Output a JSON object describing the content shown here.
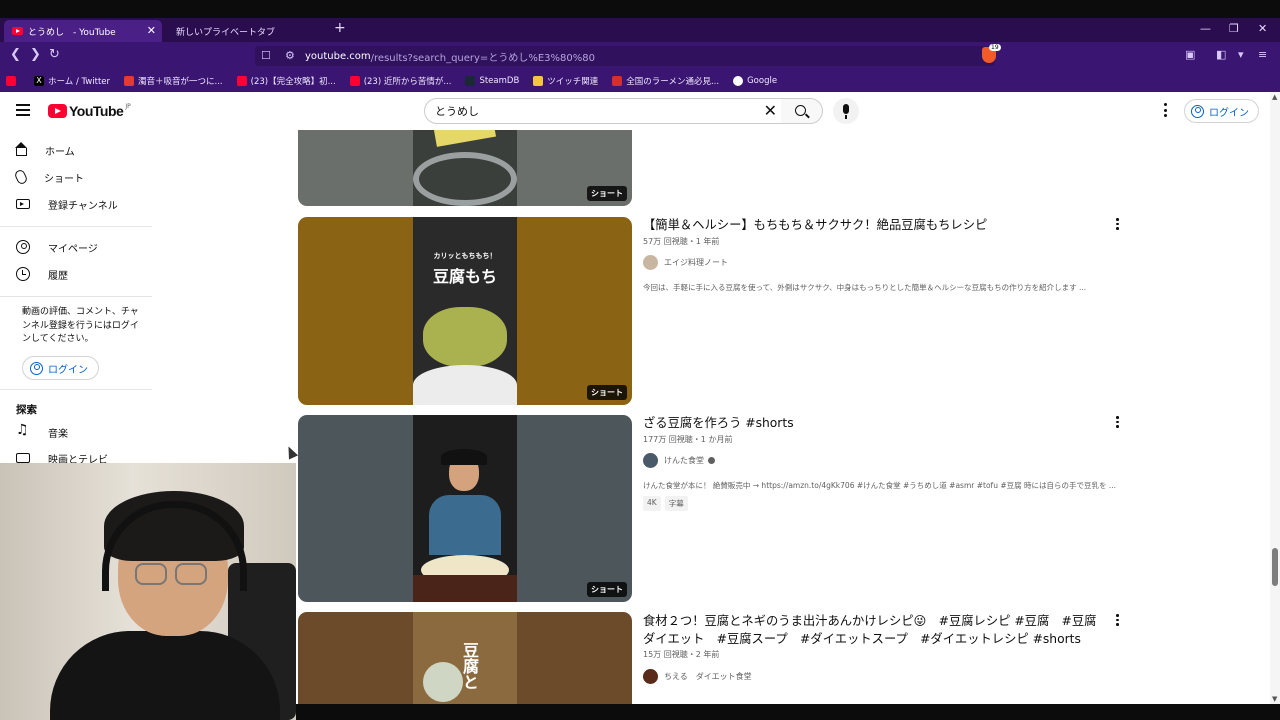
{
  "browser": {
    "tabs": [
      {
        "label": "とうめし　- YouTube",
        "active": true
      },
      {
        "label": "新しいプライベートタブ",
        "active": false
      }
    ],
    "new_tab": "+",
    "close": "✕",
    "window_controls": {
      "minimize": "—",
      "restore": "❐",
      "close": "✕"
    },
    "nav": {
      "back": "❮",
      "forward": "❯",
      "reload": "↻"
    },
    "url_host": "youtube.com",
    "url_path": "/results?search_query=とうめし%E3%80%80",
    "brave_count": "19",
    "bookmarks": [
      {
        "label": "ホーム / Twitter",
        "color": "#000000"
      },
      {
        "label": "濁音＋吸音が一つに...",
        "color": "#ff0033"
      },
      {
        "label": "(23)【完全攻略】初...",
        "color": "#ff0033"
      },
      {
        "label": "(23) 近所から苦情が...",
        "color": "#ff0033"
      },
      {
        "label": "SteamDB",
        "color": "#1b2838"
      },
      {
        "label": "ツイッチ関連",
        "color": "#f5c542"
      },
      {
        "label": "全国のラーメン通必見...",
        "color": "#d32f2f"
      },
      {
        "label": "Google",
        "color": "#ffffff"
      }
    ]
  },
  "youtube": {
    "logo_text": "YouTube",
    "logo_region": "JP",
    "search_value": "とうめし",
    "clear_icon": "✕",
    "login_label": "ログイン",
    "sidebar": {
      "items": [
        {
          "label": "ホーム",
          "icon": "home-icon"
        },
        {
          "label": "ショート",
          "icon": "shorts-icon"
        },
        {
          "label": "登録チャンネル",
          "icon": "subscriptions-icon"
        },
        {
          "label": "マイページ",
          "icon": "you-icon"
        },
        {
          "label": "履歴",
          "icon": "history-icon"
        }
      ],
      "note": "動画の評価、コメント、チャンネル登録を行うにはログインしてください。",
      "login_label": "ログイン",
      "explore_heading": "探索",
      "explore_items": [
        {
          "label": "音楽",
          "icon": "music-icon"
        },
        {
          "label": "映画とテレビ",
          "icon": "movie-icon"
        }
      ]
    },
    "results": [
      {
        "badge": "ショート",
        "thumb_side": "#6a6f6b",
        "thumb_center": "#3b3f3c"
      },
      {
        "title": "【簡単＆ヘルシー】もちもち＆サクサク！絶品豆腐もちレシピ",
        "meta": "57万 回視聴・1 年前",
        "channel": "エイジ料理ノート",
        "description": "今回は、手軽に手に入る豆腐を使って、外側はサクサク、中身はもっちりとした簡単＆ヘルシーな豆腐もちの作り方を紹介します ...",
        "badge": "ショート",
        "thumb_caption_small": "カリッともちもち！",
        "thumb_caption_big": "豆腐もち",
        "thumb_side": "#8a6414",
        "thumb_center": "#2a2a2a"
      },
      {
        "title": "ざる豆腐を作ろう #shorts",
        "meta": "177万 回視聴・1 か月前",
        "channel": "けんた食堂",
        "verified": true,
        "description": "けんた食堂が本に！ 絶賛販売中 → https://amzn.to/4gKk706 #けんた食堂 #うちめし道 #asmr #tofu #豆腐 時には自らの手で豆乳を ...",
        "chips": [
          "4K",
          "字幕"
        ],
        "badge": "ショート",
        "thumb_side": "#4d575b",
        "thumb_center": "#1d1d1d"
      },
      {
        "title": "食材２つ！豆腐とネギのうま出汁あんかけレシピ😜　#豆腐レシピ #豆腐　#豆腐ダイエット　#豆腐スープ　#ダイエットスープ　#ダイエットレシピ #shorts",
        "meta": "15万 回視聴・2 年前",
        "channel": "ちえる　ダイエット食堂",
        "thumb_caption_big": "豆腐と",
        "thumb_side": "#6b4b2a",
        "thumb_center": "#8c6a3f"
      }
    ]
  }
}
